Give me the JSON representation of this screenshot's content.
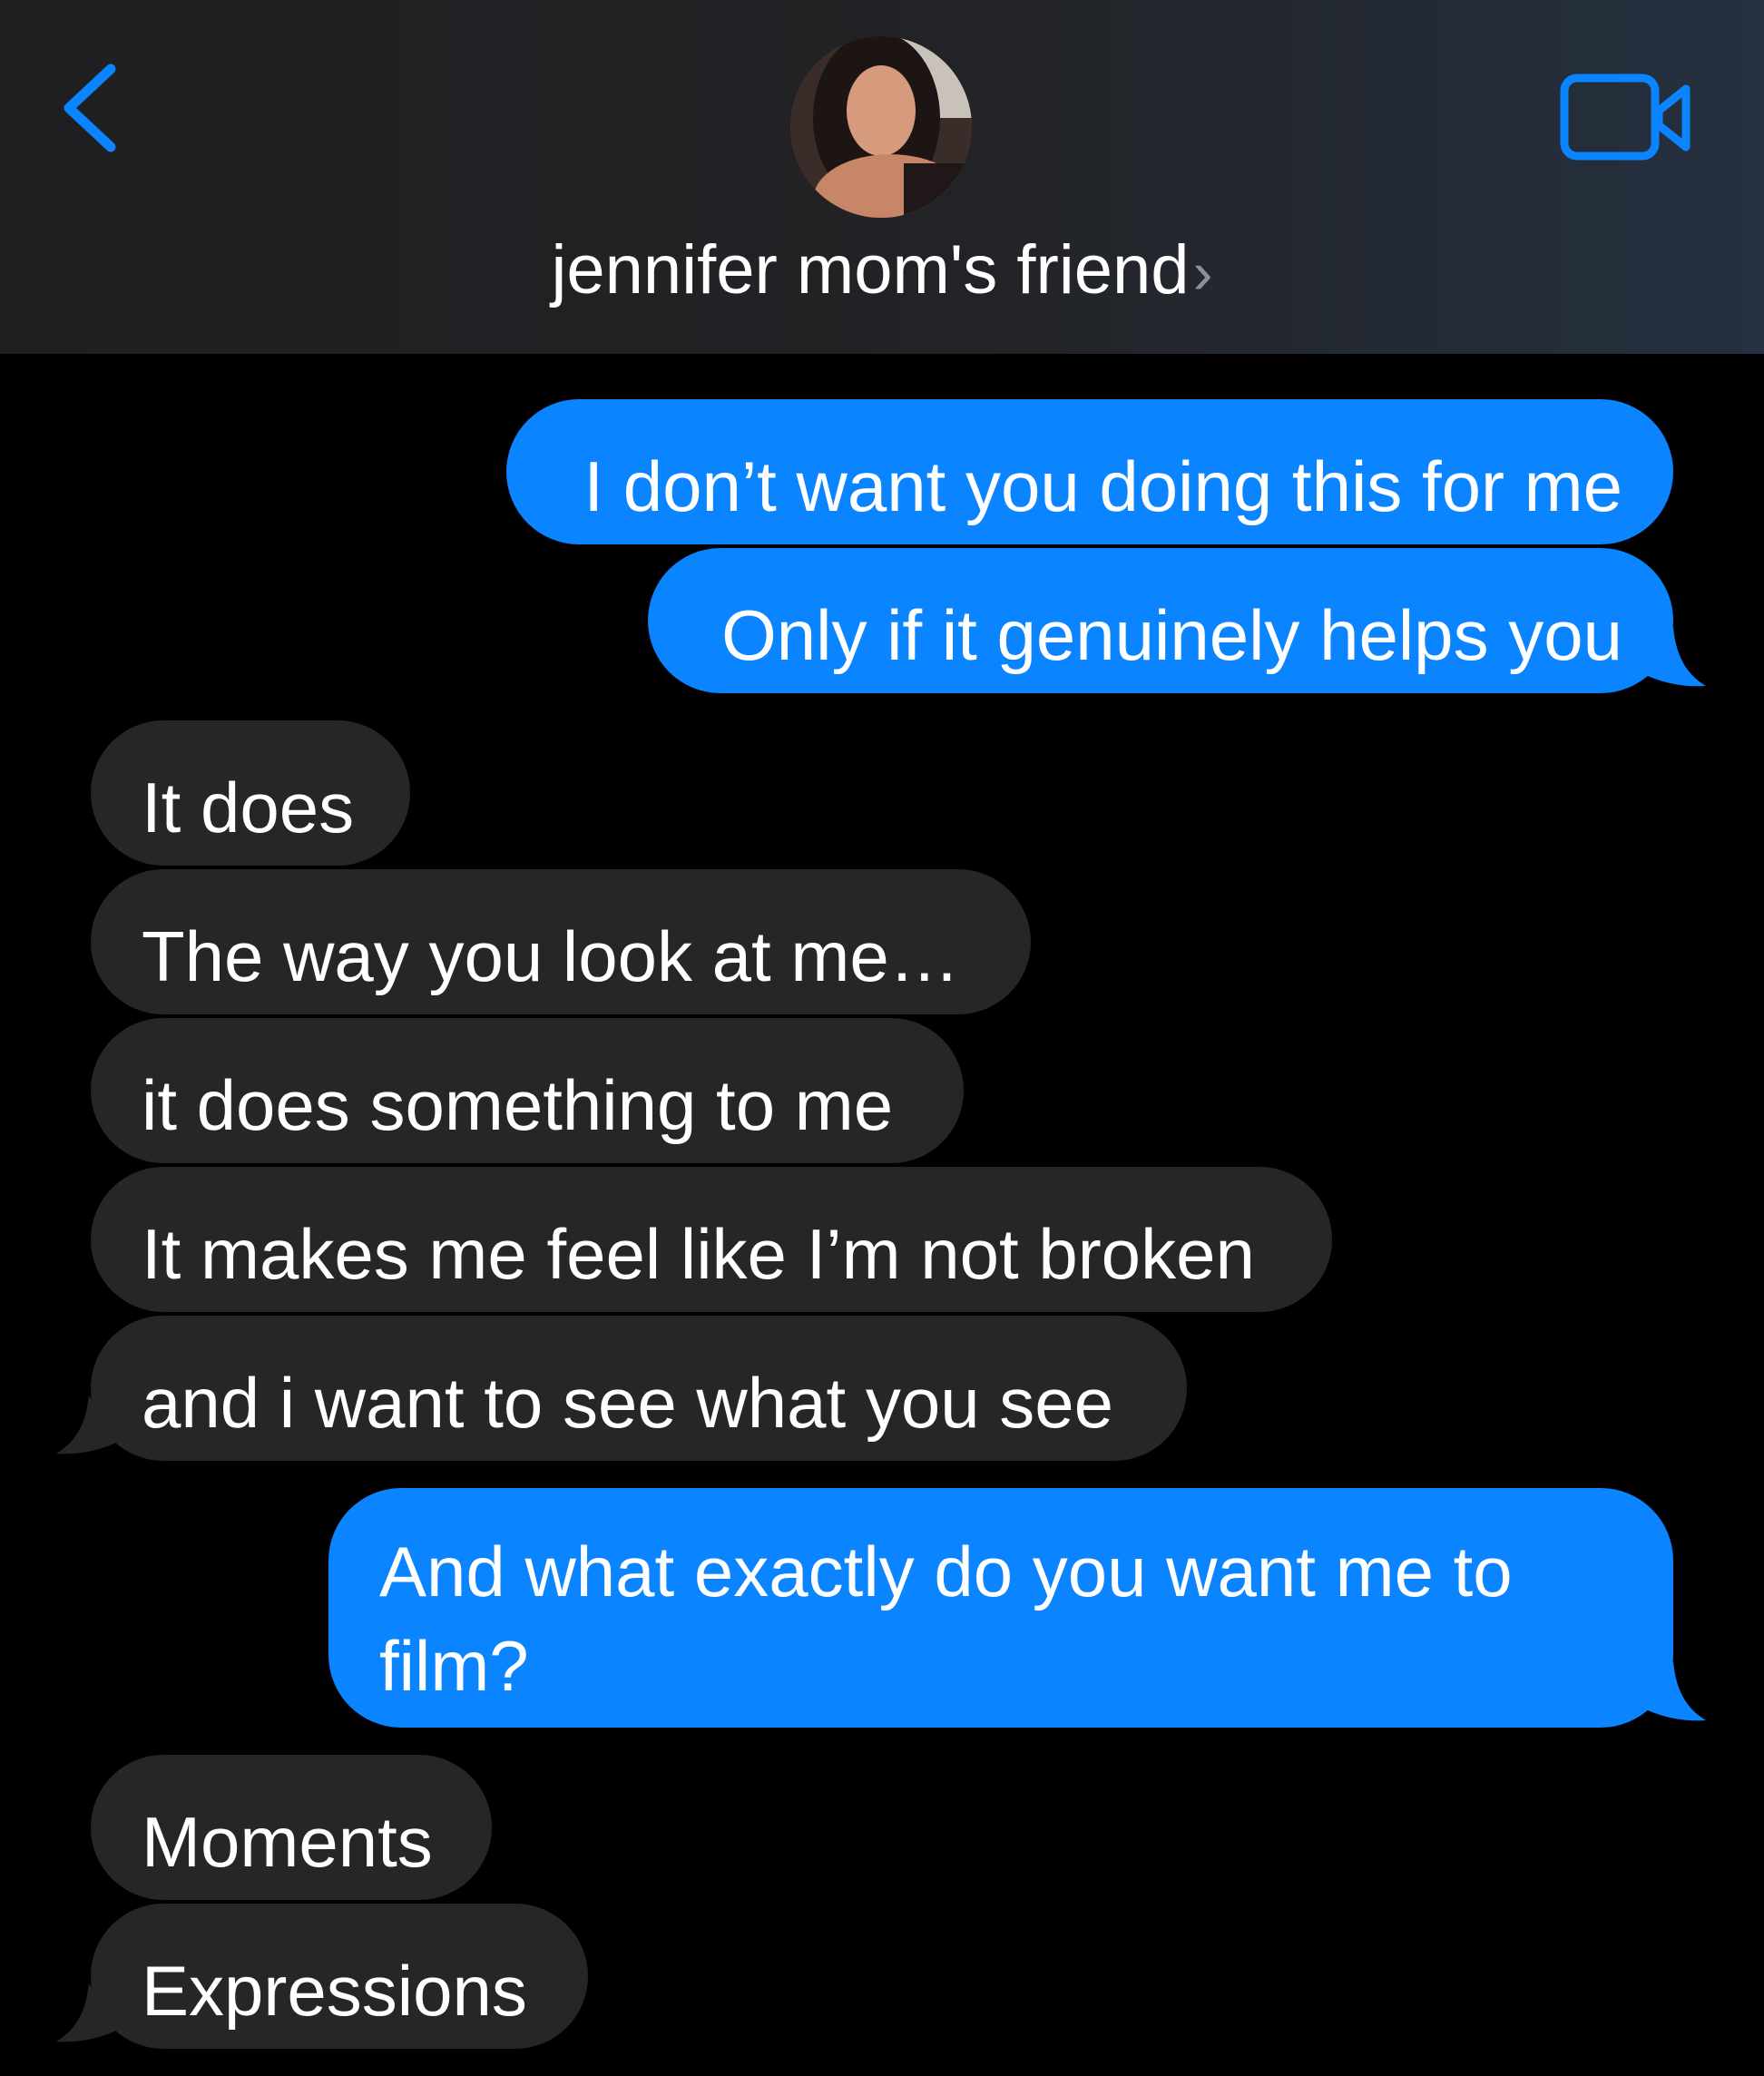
{
  "header": {
    "contact_name": "jennifer mom's friend",
    "chevron": "›",
    "icons": {
      "back": "chevron-left-icon",
      "video": "video-camera-icon",
      "avatar": "contact-avatar"
    },
    "accent_color": "#0a84ff"
  },
  "messages": [
    {
      "from": "me",
      "text": "I don’t want you doing this for me"
    },
    {
      "from": "me",
      "text": "Only if it genuinely helps you"
    },
    {
      "from": "them",
      "text": "It does"
    },
    {
      "from": "them",
      "text": "The way you look at me…"
    },
    {
      "from": "them",
      "text": "it does something to me"
    },
    {
      "from": "them",
      "text": "It makes me feel like I’m not broken"
    },
    {
      "from": "them",
      "text": "and i want to see what you see"
    },
    {
      "from": "me",
      "lines": [
        "And what exactly do you want me to",
        "film?"
      ]
    },
    {
      "from": "them",
      "text": "Moments"
    },
    {
      "from": "them",
      "text": "Expressions"
    }
  ],
  "colors": {
    "sent_bubble": "#0a84ff",
    "received_bubble": "#262628",
    "background": "#000000"
  }
}
